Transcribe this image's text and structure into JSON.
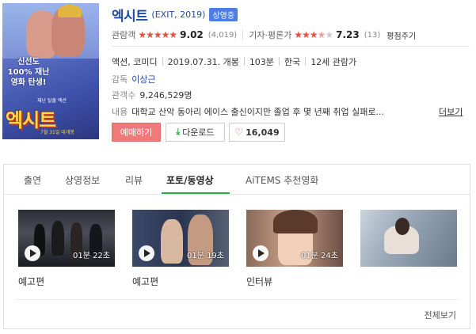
{
  "movie": {
    "poster": {
      "tagline": "신선도 100% 재난영화 탄생!",
      "logo_text": "엑시트",
      "small_text": "재난 탈출 액션",
      "date_text": "7월 31일 대개봉"
    },
    "title": "엑시트",
    "subtitle": "(EXIT, 2019)",
    "status_badge": "상영중",
    "ratings": {
      "audience_label": "관람객",
      "audience_score": "9.02",
      "audience_count": "(4,019)",
      "critic_label": "기자·평론가",
      "critic_score": "7.23",
      "critic_count": "(13)",
      "evaluate_label": "평점주기",
      "audience_stars": "★★★★★",
      "critic_stars_full": "★★★",
      "critic_stars_half": "★",
      "critic_stars_empty": "★"
    },
    "genre": "액션, 코미디",
    "release": "2019.07.31. 개봉",
    "runtime": "103분",
    "country": "한국",
    "rating": "12세 관람가",
    "director_label": "감독",
    "director": "이상근",
    "audience_label": "관객수",
    "audience_total": "9,246,529명",
    "plot_label": "내용",
    "plot": "대학교 산악 동아리 에이스 출신이지만 졸업 후 몇 년째 취업 실패로...",
    "plot_more": "더보기"
  },
  "buttons": {
    "reserve": "예매하기",
    "download": "다운로드",
    "like_count": "16,049",
    "download_icon": "download-arrow",
    "like_icon": "heart-outline"
  },
  "tabs": [
    "출연",
    "상영정보",
    "리뷰",
    "포토/동영상",
    "AiTEMS 추천영화"
  ],
  "active_tab": "포토/동영상",
  "videos": [
    {
      "duration": "01분 22초",
      "label": "예고편"
    },
    {
      "duration": "01분 19초",
      "label": "예고편"
    },
    {
      "duration": "01분 24초",
      "label": "인터뷰"
    },
    {
      "duration": "",
      "label": ""
    }
  ],
  "view_all": "전체보기",
  "colors": {
    "title_blue": "#1f4aa8",
    "star_red": "#e84e3d",
    "badge_blue": "#4c7de0",
    "reserve_pink": "#f07a7a",
    "tab_green": "#2aa84a"
  }
}
